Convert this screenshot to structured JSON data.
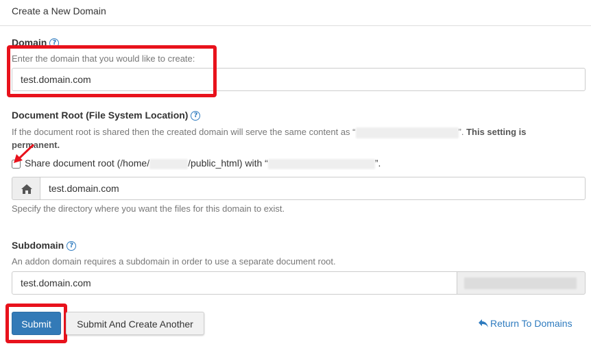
{
  "panel": {
    "title": "Create a New Domain"
  },
  "domain": {
    "label": "Domain",
    "help": "Enter the domain that you would like to create:",
    "value": "test.domain.com"
  },
  "docroot": {
    "label": "Document Root (File System Location)",
    "help_prefix": "If the document root is shared then the created domain will serve the same content as “",
    "help_suffix": "”.",
    "help_strong": "This setting is permanent.",
    "share_prefix": "Share document root (/home/",
    "share_middle": "/public_html) with “",
    "share_suffix": "”.",
    "share_checked": false,
    "value": "test.domain.com",
    "hint": "Specify the directory where you want the files for this domain to exist."
  },
  "subdomain": {
    "label": "Subdomain",
    "help": "An addon domain requires a subdomain in order to use a separate document root.",
    "value": "test.domain.com"
  },
  "actions": {
    "submit": "Submit",
    "submit_another": "Submit And Create Another",
    "return_link": "Return To Domains"
  },
  "colors": {
    "accent": "#337ab7",
    "highlight": "#e8121c",
    "link": "#2e7bbf"
  },
  "icons": {
    "help": "question-circle-icon",
    "home": "home-icon",
    "back": "reply-arrow-icon",
    "pointer": "red-arrow-annotation-icon"
  }
}
